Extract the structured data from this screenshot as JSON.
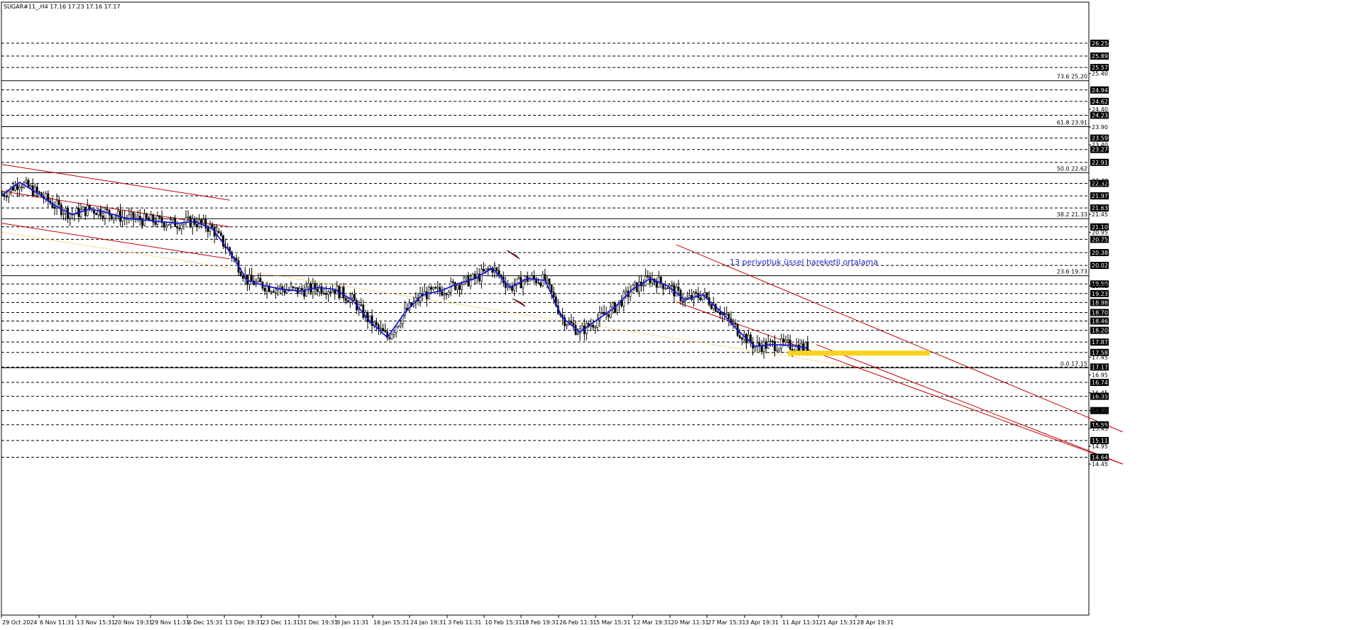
{
  "header": {
    "symbol_text": "SUGAR#11_,H4  17.16 17.23 17.16 17.17"
  },
  "annotation": {
    "text": "13 periyotluk üssel hareketli ortalama"
  },
  "chart_data": {
    "type": "candlestick",
    "title": "SUGAR#11_,H4",
    "ohlc_header": {
      "open": 17.16,
      "high": 17.23,
      "low": 17.16,
      "close": 17.17
    },
    "ylim": [
      14.4,
      26.4
    ],
    "price_axis_ticks": [
      "25.40",
      "24.40",
      "23.90",
      "23.40",
      "22.40",
      "21.45",
      "20.95",
      "19.45",
      "17.45",
      "16.95",
      "16.45",
      "15.95",
      "15.45",
      "14.95",
      "14.45"
    ],
    "level_boxes": [
      "26.25",
      "25.89",
      "25.57",
      "24.94",
      "24.62",
      "24.23",
      "23.59",
      "23.27",
      "22.91",
      "22.32",
      "21.97",
      "21.63",
      "21.10",
      "20.75",
      "20.38",
      "20.02",
      "19.50",
      "19.23",
      "18.98",
      "18.70",
      "18.46",
      "18.20",
      "17.87",
      "17.58",
      "17.17",
      "16.74",
      "16.35",
      "15.95",
      "15.55",
      "15.11",
      "14.64"
    ],
    "x_labels": [
      "29 Oct 2024",
      "6 Nov 11:31",
      "13 Nov 15:31",
      "20 Nov 19:31",
      "29 Nov 11:31",
      "6 Dec 15:31",
      "13 Dec 19:31",
      "23 Dec 11:31",
      "31 Dec 19:31",
      "9 Jan 11:31",
      "16 Jan 15:31",
      "24 Jan 19:31",
      "3 Feb 11:31",
      "10 Feb 15:31",
      "18 Feb 19:31",
      "26 Feb 11:31",
      "5 Mar 15:31",
      "12 Mar 19:31",
      "20 Mar 11:31",
      "27 Mar 15:31",
      "3 Apr 19:31",
      "11 Apr 11:31",
      "21 Apr 15:31",
      "28 Apr 19:31"
    ],
    "fibonacci": [
      {
        "label": "73.6 25.20",
        "price": 25.2
      },
      {
        "label": "61.8 23.91",
        "price": 23.91
      },
      {
        "label": "50.0 22.62",
        "price": 22.62
      },
      {
        "label": "38.2 21.33",
        "price": 21.33
      },
      {
        "label": "23.6 19.73",
        "price": 19.73
      },
      {
        "label": "0.0 17.15",
        "price": 17.15
      }
    ],
    "series": [
      {
        "name": "13 periyotluk üssel hareketli ortalama",
        "approx_path": [
          [
            0,
            22.0
          ],
          [
            1,
            22.35
          ],
          [
            2,
            22.05
          ],
          [
            3,
            21.7
          ],
          [
            4,
            21.45
          ],
          [
            5,
            21.6
          ],
          [
            6,
            21.5
          ],
          [
            7,
            21.35
          ],
          [
            8,
            21.3
          ],
          [
            9,
            21.25
          ],
          [
            10,
            21.2
          ],
          [
            11,
            21.25
          ],
          [
            12,
            21.05
          ],
          [
            13,
            20.4
          ],
          [
            14,
            19.6
          ],
          [
            15,
            19.45
          ],
          [
            16,
            19.35
          ],
          [
            17,
            19.3
          ],
          [
            18,
            19.4
          ],
          [
            19,
            19.35
          ],
          [
            20,
            19.05
          ],
          [
            21,
            18.45
          ],
          [
            22,
            18.0
          ],
          [
            23,
            18.7
          ],
          [
            24,
            19.2
          ],
          [
            25,
            19.3
          ],
          [
            26,
            19.5
          ],
          [
            27,
            19.65
          ],
          [
            28,
            19.95
          ],
          [
            29,
            19.4
          ],
          [
            30,
            19.65
          ],
          [
            31,
            19.6
          ],
          [
            32,
            18.55
          ],
          [
            33,
            18.15
          ],
          [
            34,
            18.5
          ],
          [
            35,
            18.85
          ],
          [
            36,
            19.35
          ],
          [
            37,
            19.65
          ],
          [
            38,
            19.45
          ],
          [
            39,
            19.05
          ],
          [
            40,
            19.2
          ],
          [
            41,
            18.75
          ],
          [
            42,
            18.2
          ],
          [
            43,
            17.75
          ],
          [
            44,
            17.8
          ],
          [
            45,
            17.78
          ],
          [
            46,
            17.7
          ]
        ]
      }
    ],
    "trend_channels": [
      {
        "name": "channel-1-upper",
        "from": [
          0,
          22.85
        ],
        "to": [
          13,
          21.85
        ]
      },
      {
        "name": "channel-1-mid",
        "from": [
          0,
          22.1
        ],
        "to": [
          13,
          21.1
        ]
      },
      {
        "name": "channel-1-lower",
        "from": [
          0,
          21.2
        ],
        "to": [
          13,
          20.2
        ]
      },
      {
        "name": "channel-2-upper",
        "from": [
          38.5,
          20.6
        ],
        "to": [
          64,
          15.35
        ]
      },
      {
        "name": "channel-2-mid",
        "from": [
          38.5,
          19.0
        ],
        "to": [
          64,
          14.45
        ]
      },
      {
        "name": "channel-2-lower",
        "from": [
          46.5,
          17.8
        ],
        "to": [
          64,
          14.45
        ]
      }
    ],
    "support_zone": {
      "price_low": 17.49,
      "price_high": 17.63
    },
    "grid": false,
    "legend": "none"
  },
  "colors": {
    "background": "#ffffff",
    "candle": "#000000",
    "ema": "#1a1ad6",
    "channel": "#c00000",
    "fib": "#000000",
    "support_zone": "#f8d21c",
    "long_trend": "#f0c030",
    "annotation": "#1f1fd0"
  }
}
